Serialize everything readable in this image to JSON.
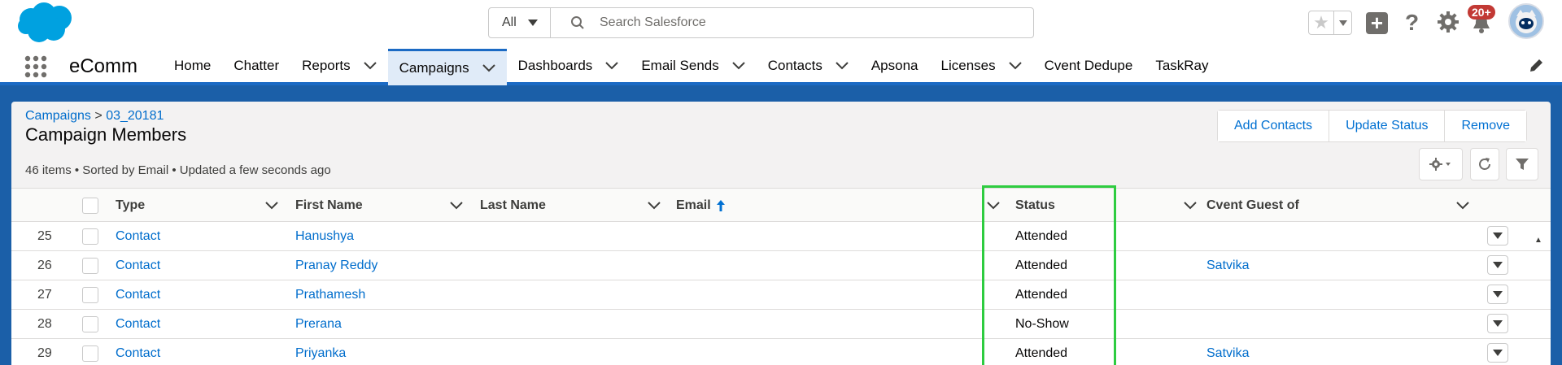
{
  "header": {
    "search_scope": "All",
    "search_placeholder": "Search Salesforce",
    "notifications_badge": "20+"
  },
  "nav": {
    "app_name": "eComm",
    "items": [
      {
        "label": "Home",
        "dropdown": false
      },
      {
        "label": "Chatter",
        "dropdown": false
      },
      {
        "label": "Reports",
        "dropdown": true
      },
      {
        "label": "Campaigns",
        "dropdown": true,
        "active": true
      },
      {
        "label": "Dashboards",
        "dropdown": true
      },
      {
        "label": "Email Sends",
        "dropdown": true
      },
      {
        "label": "Contacts",
        "dropdown": true
      },
      {
        "label": "Apsona",
        "dropdown": false
      },
      {
        "label": "Licenses",
        "dropdown": true
      },
      {
        "label": "Cvent Dedupe",
        "dropdown": false
      },
      {
        "label": "TaskRay",
        "dropdown": false
      }
    ]
  },
  "page": {
    "breadcrumb_root": "Campaigns",
    "breadcrumb_sep": ">",
    "breadcrumb_child": "03_20181",
    "title": "Campaign Members",
    "meta": "46 items • Sorted by Email • Updated a few seconds ago",
    "buttons": {
      "add_contacts": "Add Contacts",
      "update_status": "Update Status",
      "remove": "Remove"
    }
  },
  "table": {
    "columns": {
      "type": "Type",
      "first_name": "First Name",
      "last_name": "Last Name",
      "email": "Email",
      "status": "Status",
      "guest": "Cvent Guest of"
    },
    "rows": [
      {
        "num": "25",
        "type": "Contact",
        "first_name": "Hanushya",
        "last_name": "",
        "email": "",
        "status": "Attended",
        "guest": ""
      },
      {
        "num": "26",
        "type": "Contact",
        "first_name": "Pranay Reddy",
        "last_name": "",
        "email": "",
        "status": "Attended",
        "guest": "Satvika"
      },
      {
        "num": "27",
        "type": "Contact",
        "first_name": "Prathamesh",
        "last_name": "",
        "email": "",
        "status": "Attended",
        "guest": ""
      },
      {
        "num": "28",
        "type": "Contact",
        "first_name": "Prerana",
        "last_name": "",
        "email": "",
        "status": "No-Show",
        "guest": ""
      },
      {
        "num": "29",
        "type": "Contact",
        "first_name": "Priyanka",
        "last_name": "",
        "email": "",
        "status": "Attended",
        "guest": "Satvika"
      }
    ]
  },
  "colors": {
    "brand_blue": "#1b6ac4",
    "link": "#006dcc",
    "highlight": "#2ecc40",
    "badge": "#c23934"
  }
}
